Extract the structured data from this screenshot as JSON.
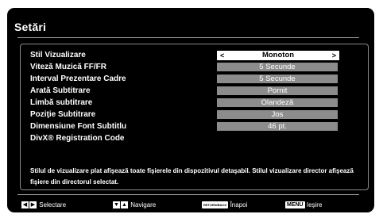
{
  "title": "Setări",
  "settings": [
    {
      "label": "Stil Vizualizare",
      "value": "Monoton",
      "selected": true
    },
    {
      "label": "Viteză Muzică FF/FR",
      "value": "5 Secunde"
    },
    {
      "label": "Interval Prezentare Cadre",
      "value": "5 Secunde"
    },
    {
      "label": "Arată Subtitrare",
      "value": "Pornit"
    },
    {
      "label": "Limbă subtitrare",
      "value": "Olandeză"
    },
    {
      "label": "Poziţie Subtitrare",
      "value": "Jos"
    },
    {
      "label": "Dimensiune Font Subtitlu",
      "value": "46 pt."
    },
    {
      "label": "DivX® Registration Code",
      "value": ""
    }
  ],
  "arrows": {
    "left": "<",
    "right": ">"
  },
  "description": "Stilul de vizualizare plat afişează toate fişierele din dispozitivul detaşabil. Stilul vizualizare director afişează fişiere din directorul selectat.",
  "footer": {
    "select_label": "Selectare",
    "nav_label": "Navigare",
    "back_key": "RETURN/BACK",
    "back_label": "Înapoi",
    "menu_key": "MENU",
    "exit_label": "Ieşire"
  }
}
